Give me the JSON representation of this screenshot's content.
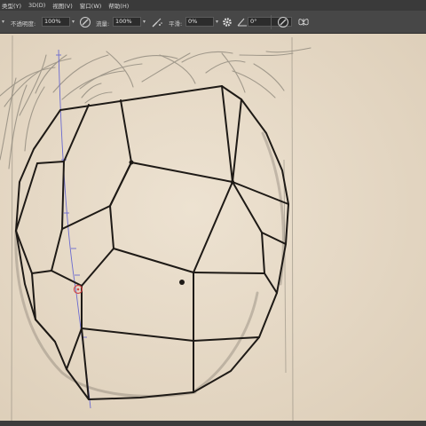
{
  "menu": {
    "items": [
      "类型(Y)",
      "3D(D)",
      "视图(V)",
      "窗口(W)",
      "帮助(H)"
    ]
  },
  "options": {
    "opacity_label": "不透明度:",
    "opacity_value": "100%",
    "flow_label": "流量:",
    "flow_value": "100%",
    "smoothing_label": "平滑:",
    "smoothing_value": "0%",
    "angle_value": "0°"
  },
  "icons": {
    "pressure_opacity": "pen-pressure-icon",
    "airbrush": "airbrush-icon",
    "smoothing_gear": "gear-icon",
    "angle": "angle-icon",
    "pressure_size": "pen-pressure-size-icon",
    "symmetry": "butterfly-symmetry-icon"
  },
  "colors": {
    "menubar": "#3a3a3a",
    "optionsbar": "#474747",
    "paper": "#e6d9c6",
    "ink": "#1e1a16",
    "guide": "#6a6ad0",
    "marker": "#d04848"
  }
}
